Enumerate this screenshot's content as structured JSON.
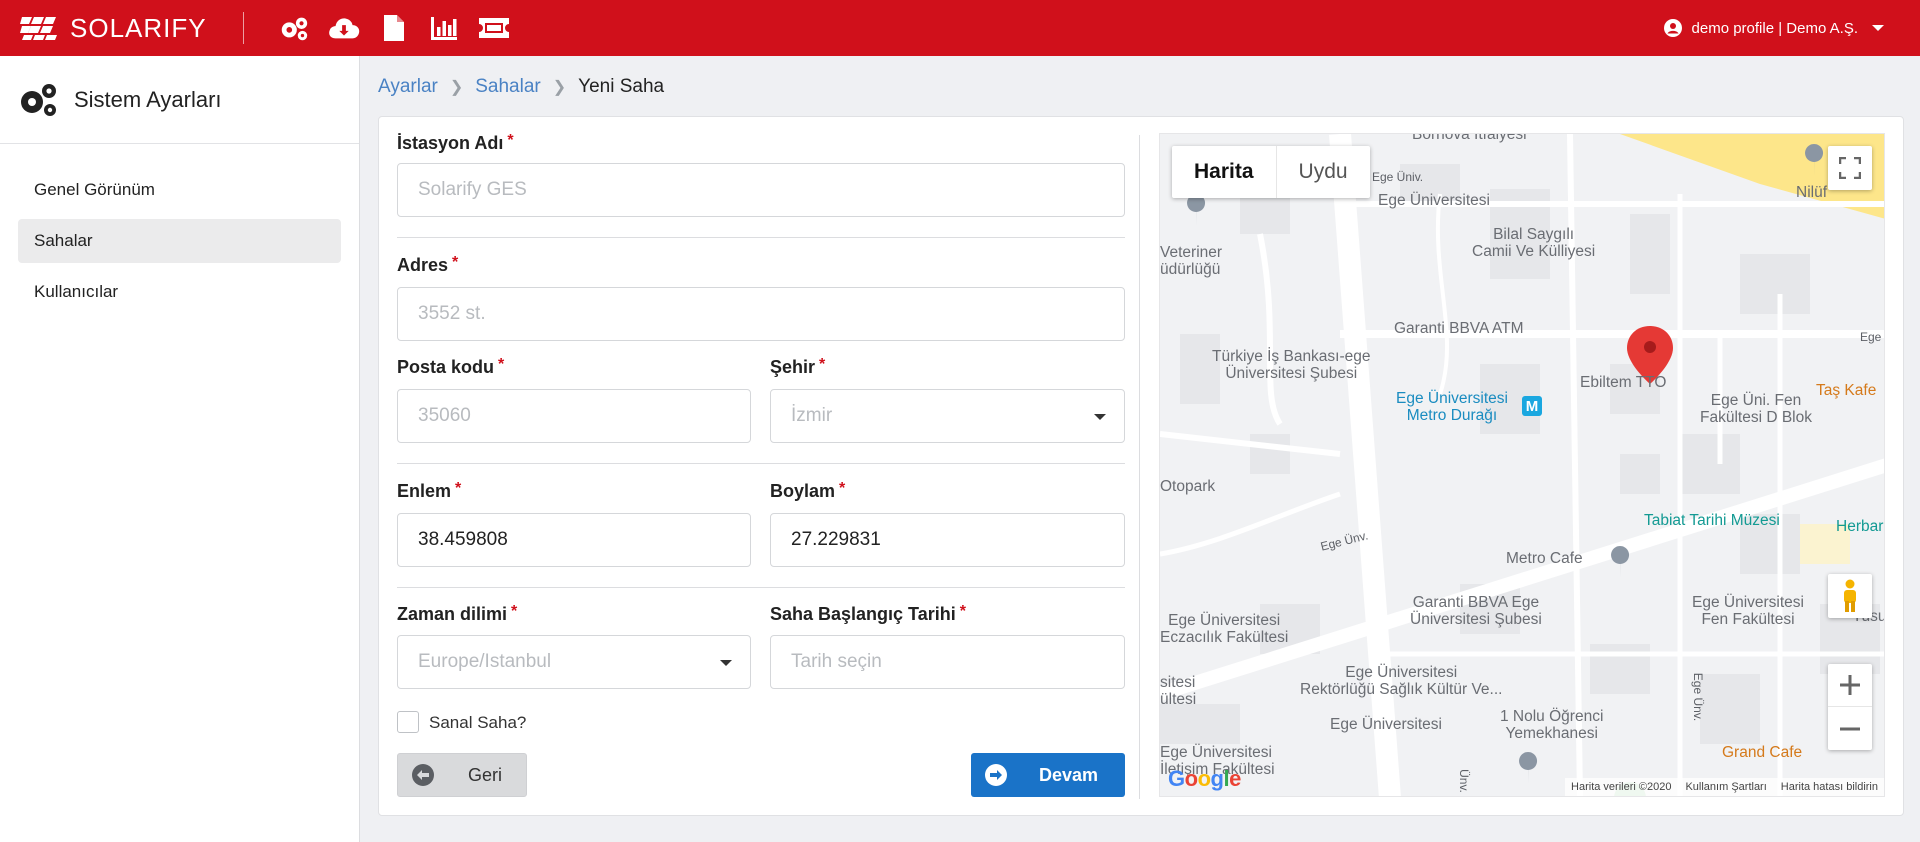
{
  "app": {
    "brand": "SOLARIFY"
  },
  "topbar": {
    "icons": [
      "settings-icon",
      "cloud-download-icon",
      "document-icon",
      "bar-chart-icon",
      "ticket-icon"
    ],
    "profile_label": "demo profile | Demo A.Ş."
  },
  "sidebar": {
    "title": "Sistem Ayarları",
    "items": [
      {
        "label": "Genel Görünüm",
        "active": false
      },
      {
        "label": "Sahalar",
        "active": true
      },
      {
        "label": "Kullanıcılar",
        "active": false
      }
    ]
  },
  "breadcrumb": {
    "items": [
      "Ayarlar",
      "Sahalar"
    ],
    "current": "Yeni Saha"
  },
  "form": {
    "station_name": {
      "label": "İstasyon Adı",
      "placeholder": "Solarify GES",
      "value": ""
    },
    "address": {
      "label": "Adres",
      "placeholder": "3552 st.",
      "value": ""
    },
    "postal_code": {
      "label": "Posta kodu",
      "placeholder": "35060",
      "value": ""
    },
    "city": {
      "label": "Şehir",
      "selected": "İzmir"
    },
    "latitude": {
      "label": "Enlem",
      "value": "38.459808"
    },
    "longitude": {
      "label": "Boylam",
      "value": "27.229831"
    },
    "timezone": {
      "label": "Zaman dilimi",
      "selected": "Europe/Istanbul"
    },
    "start_date": {
      "label": "Saha Başlangıç Tarihi",
      "placeholder": "Tarih seçin"
    },
    "virtual_site": {
      "label": "Sanal Saha?",
      "checked": false
    },
    "required_mark": "*",
    "back_label": "Geri",
    "next_label": "Devam"
  },
  "map": {
    "type_options": [
      "Harita",
      "Uydu"
    ],
    "selected_type": "Harita",
    "labels": {
      "bornova": "Bornova İtfaiyesi",
      "ege_univ_top": "Ege Üniversitesi",
      "road_ege_univ_1": "Ege Üniv.",
      "niluf": "Nilüf",
      "veteriner": "Veteriner\nüdürlüğü",
      "bilal": "Bilal Saygılı\nCamii Ve Külliyesi",
      "garanti_atm": "Garanti BBVA ATM",
      "is_bankasi": "Türkiye İş Bankası-ege\nÜniversitesi Şubesi",
      "ege_metro": "Ege Üniversitesi\nMetro Durağı",
      "ebiltem": "Ebiltem TTO",
      "tas_kafe": "Taş Kafe",
      "fen_d": "Ege Üni. Fen\nFakültesi D Blok",
      "otopark": "Otopark",
      "tabiat": "Tabiat Tarihi Müzesi",
      "herbar": "Herbar",
      "road_ege_univ_2": "Ege Ünv.",
      "metro_cafe": "Metro Cafe",
      "garanti_ege": "Garanti BBVA Ege\nÜniversitesi Şubesi",
      "fen_fak": "Ege Üniversitesi\nFen Fakültesi",
      "yusuf": "Yusuf",
      "eczacilik": "Ege Üniversitesi\nEczacılık Fakültesi",
      "sitesi": "sitesi\nültesi",
      "rektorlugu": "Ege Üniversitesi\nRektörlüğü Sağlık Kültür Ve...",
      "ege_univ_bottom": "Ege Üniversitesi",
      "yemekhane": "1 Nolu Öğrenci\nYemekhanesi",
      "grand_cafe": "Grand Cafe",
      "iletisim": "Ege Üniversitesi\nİletişim Fakültesi",
      "ege_univ_side": "Ege Ünv.",
      "eg_right": "Ege",
      "univ_bottom_road": "Ünv."
    },
    "attribution": [
      "Harita verileri ©2020",
      "Kullanım Şartları",
      "Harita hatası bildirin"
    ],
    "google_logo": "Google"
  },
  "colors": {
    "brand_red": "#d0101b",
    "primary_blue": "#1a73c8",
    "link_blue": "#4a82c4"
  }
}
